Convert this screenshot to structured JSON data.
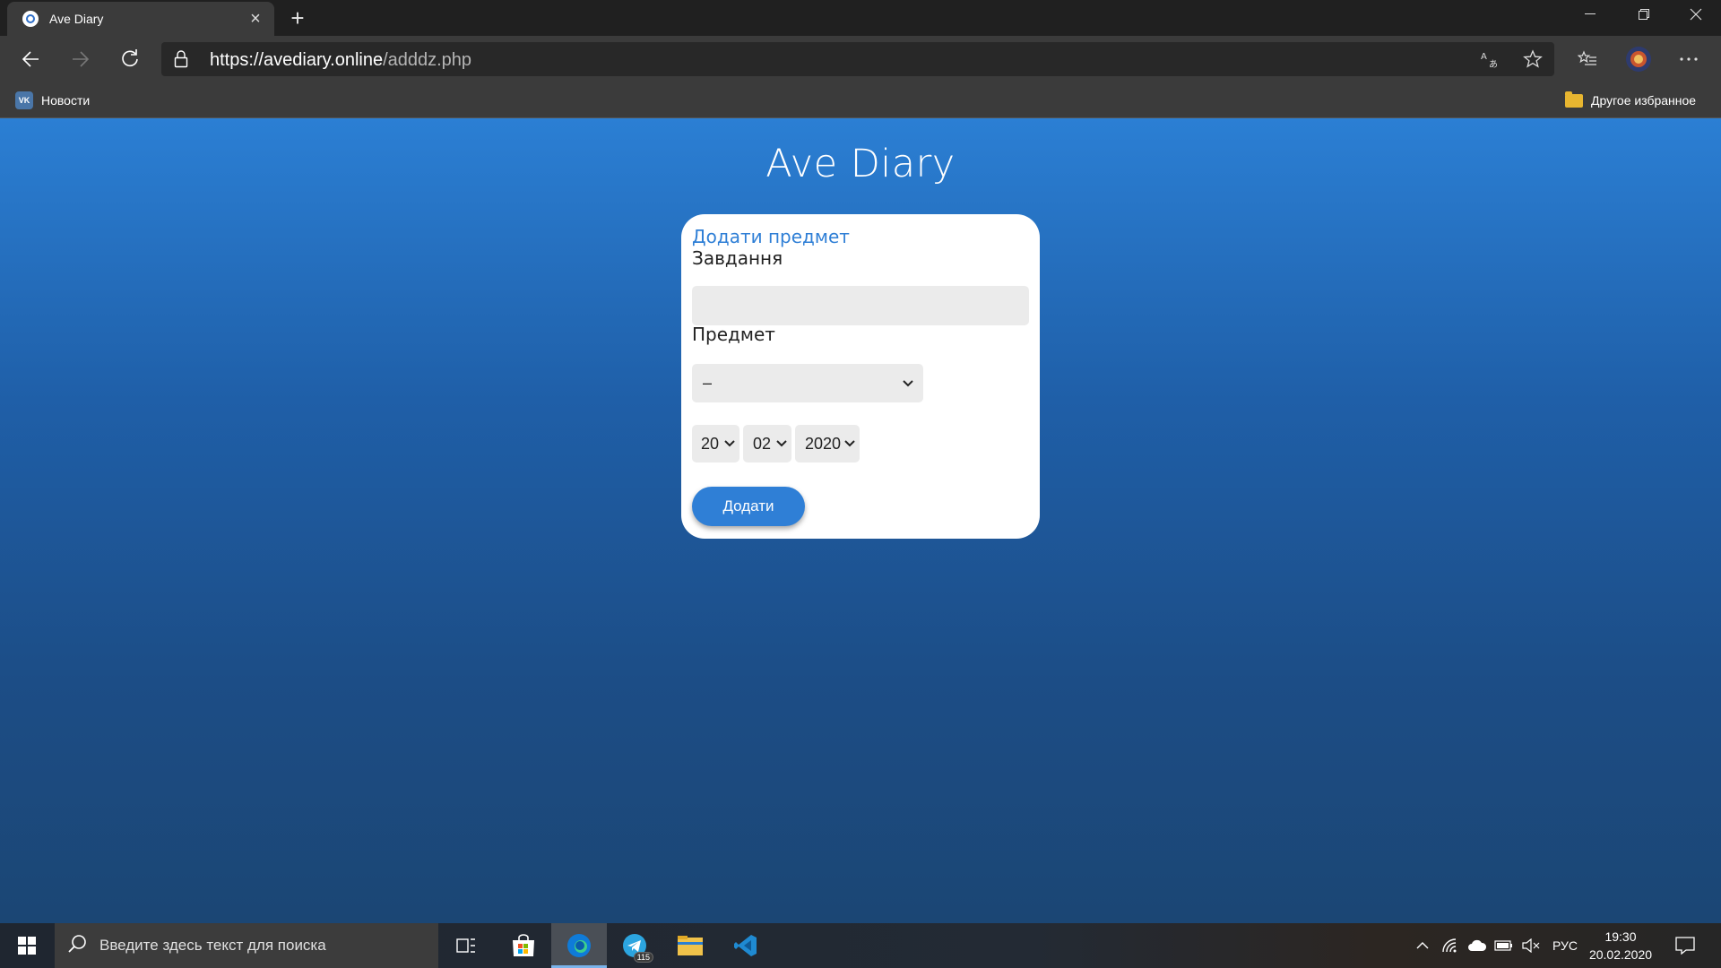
{
  "browser": {
    "tab_title": "Ave Diary",
    "url_host": "https://avediary.online",
    "url_path": "/adddz.php",
    "favorites": [
      {
        "label": "Новости",
        "icon": "vk-icon"
      },
      {
        "label": "Другое избранное",
        "icon": "folder-icon"
      }
    ]
  },
  "page": {
    "site_title": "Ave Diary",
    "card_title": "Додати предмет",
    "task_label": "Завдання",
    "task_value": "",
    "subject_label": "Предмет",
    "subject_selected": "–",
    "date": {
      "day": "20",
      "month": "02",
      "year": "2020"
    },
    "submit_label": "Додати"
  },
  "taskbar": {
    "search_placeholder": "Введите здесь текст для поиска",
    "telegram_badge": "115",
    "language": "РУС",
    "time": "19:30",
    "date": "20.02.2020"
  },
  "colors": {
    "accent": "#2f7fd6",
    "page_gradient_top": "#2b7fd4",
    "page_gradient_bottom": "#1b4674"
  }
}
